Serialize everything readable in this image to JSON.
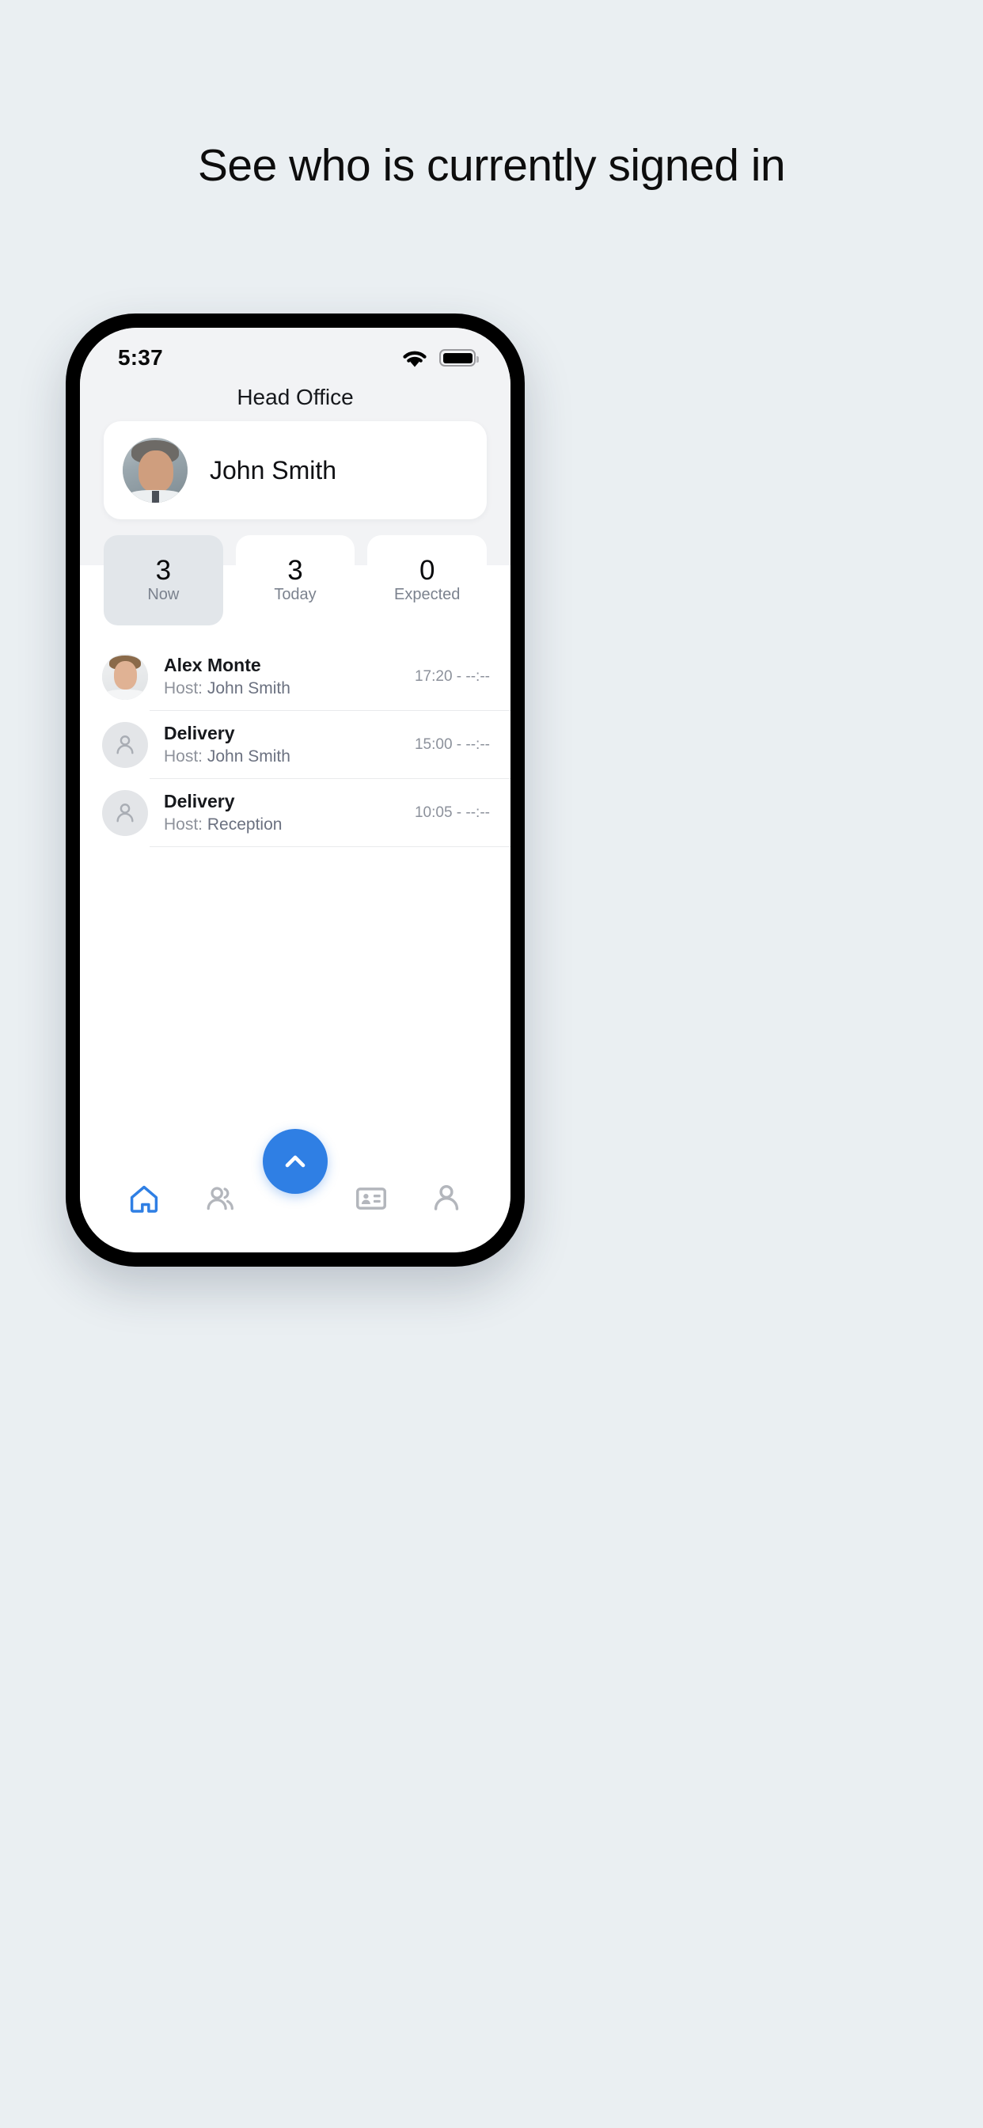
{
  "headline": "See who is currently signed in",
  "status_bar": {
    "time": "5:37",
    "wifi_icon": "wifi-icon",
    "battery_icon": "battery-full-icon"
  },
  "app": {
    "page_title": "Head Office",
    "profile": {
      "name": "John Smith",
      "avatar": "photo-avatar-john-smith"
    },
    "stats": [
      {
        "value": "3",
        "label": "Now",
        "active": true
      },
      {
        "value": "3",
        "label": "Today",
        "active": false
      },
      {
        "value": "0",
        "label": "Expected",
        "active": false
      }
    ],
    "list": [
      {
        "name": "Alex Monte",
        "host_prefix": "Host:",
        "host": "John Smith",
        "time": "17:20 - --:--",
        "avatar": "photo-avatar-alex-monte"
      },
      {
        "name": "Delivery",
        "host_prefix": "Host:",
        "host": "John Smith",
        "time": "15:00 - --:--",
        "avatar": "placeholder-person-avatar"
      },
      {
        "name": "Delivery",
        "host_prefix": "Host:",
        "host": "Reception",
        "time": "10:05 - --:--",
        "avatar": "placeholder-person-avatar"
      }
    ],
    "nav": [
      {
        "icon": "home-icon",
        "active": true
      },
      {
        "icon": "people-icon",
        "active": false
      },
      {
        "icon": "id-card-icon",
        "active": false
      },
      {
        "icon": "person-icon",
        "active": false
      }
    ],
    "fab": {
      "icon": "chevron-up-icon"
    }
  },
  "colors": {
    "accent": "#2f7fe4",
    "page_background": "#eaeff2",
    "screen_top": "#f2f3f5",
    "stat_active": "#e2e6ea",
    "muted_text": "#8e929b"
  }
}
